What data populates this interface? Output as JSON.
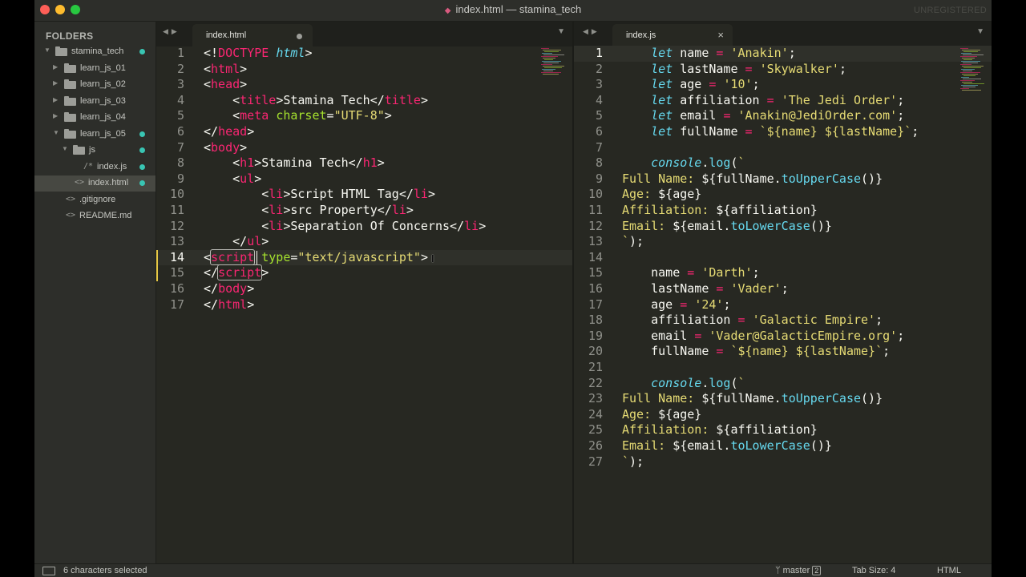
{
  "window": {
    "title": "index.html — stamina_tech",
    "unregistered": "UNREGISTERED"
  },
  "sidebar": {
    "header": "FOLDERS",
    "items": [
      {
        "label": "stamina_tech",
        "type": "folder",
        "expanded": true,
        "level": 0,
        "dot": true
      },
      {
        "label": "learn_js_01",
        "type": "folder",
        "expanded": false,
        "level": 1,
        "dot": false
      },
      {
        "label": "learn_js_02",
        "type": "folder",
        "expanded": false,
        "level": 1,
        "dot": false
      },
      {
        "label": "learn_js_03",
        "type": "folder",
        "expanded": false,
        "level": 1,
        "dot": false
      },
      {
        "label": "learn_js_04",
        "type": "folder",
        "expanded": false,
        "level": 1,
        "dot": false
      },
      {
        "label": "learn_js_05",
        "type": "folder",
        "expanded": true,
        "level": 1,
        "dot": true
      },
      {
        "label": "js",
        "type": "folder",
        "expanded": true,
        "level": 2,
        "dot": true
      },
      {
        "label": "index.js",
        "type": "file",
        "icon": "/*",
        "level": 3,
        "dot": true
      },
      {
        "label": "index.html",
        "type": "file",
        "icon": "<>",
        "level": 2,
        "dot": true,
        "selected": true
      },
      {
        "label": ".gitignore",
        "type": "file",
        "icon": "<>",
        "level": 1,
        "dot": false
      },
      {
        "label": "README.md",
        "type": "file",
        "icon": "<>",
        "level": 1,
        "dot": false
      }
    ]
  },
  "left_pane": {
    "tab_label": "index.html",
    "current_line": 14,
    "dirty_lines": [
      14,
      15
    ],
    "lines": [
      [
        [
          "<!"
        ],
        [
          "DOCTYPE",
          "tag"
        ],
        [
          " "
        ],
        [
          "html",
          "kw2"
        ],
        [
          ">"
        ]
      ],
      [
        [
          "<"
        ],
        [
          "html",
          "tag"
        ],
        [
          ">"
        ]
      ],
      [
        [
          "<"
        ],
        [
          "head",
          "tag"
        ],
        [
          ">"
        ]
      ],
      [
        [
          "    <"
        ],
        [
          "title",
          "tag"
        ],
        [
          ">Stamina Tech</"
        ],
        [
          "title",
          "tag"
        ],
        [
          ">"
        ]
      ],
      [
        [
          "    <"
        ],
        [
          "meta",
          "tag"
        ],
        [
          " "
        ],
        [
          "charset",
          "attr"
        ],
        [
          "="
        ],
        [
          "\"UTF-8\"",
          "str"
        ],
        [
          ">"
        ]
      ],
      [
        [
          "</"
        ],
        [
          "head",
          "tag"
        ],
        [
          ">"
        ]
      ],
      [
        [
          "<"
        ],
        [
          "body",
          "tag"
        ],
        [
          ">"
        ]
      ],
      [
        [
          "    <"
        ],
        [
          "h1",
          "tag"
        ],
        [
          ">Stamina Tech</"
        ],
        [
          "h1",
          "tag"
        ],
        [
          ">"
        ]
      ],
      [
        [
          "    <"
        ],
        [
          "ul",
          "tag"
        ],
        [
          ">"
        ]
      ],
      [
        [
          "        <"
        ],
        [
          "li",
          "tag"
        ],
        [
          ">Script HTML Tag</"
        ],
        [
          "li",
          "tag"
        ],
        [
          ">"
        ]
      ],
      [
        [
          "        <"
        ],
        [
          "li",
          "tag"
        ],
        [
          ">src Property</"
        ],
        [
          "li",
          "tag"
        ],
        [
          ">"
        ]
      ],
      [
        [
          "        <"
        ],
        [
          "li",
          "tag"
        ],
        [
          ">Separation Of Concerns</"
        ],
        [
          "li",
          "tag"
        ],
        [
          ">"
        ]
      ],
      [
        [
          "    </"
        ],
        [
          "ul",
          "tag"
        ],
        [
          ">"
        ]
      ],
      [
        [
          "<"
        ],
        [
          "script",
          "tagsel"
        ],
        [
          " "
        ],
        [
          "type",
          "attr"
        ],
        [
          "="
        ],
        [
          "\"text/javascript\"",
          "str"
        ],
        [
          ">"
        ]
      ],
      [
        [
          "</"
        ],
        [
          "script",
          "tagsel"
        ],
        [
          ">"
        ]
      ],
      [
        [
          "</"
        ],
        [
          "body",
          "tag"
        ],
        [
          ">"
        ]
      ],
      [
        [
          "</"
        ],
        [
          "html",
          "tag"
        ],
        [
          ">"
        ]
      ]
    ]
  },
  "right_pane": {
    "tab_label": "index.js",
    "current_line": 1,
    "lines": [
      [
        [
          "    "
        ],
        [
          "let",
          "kw"
        ],
        [
          " name "
        ],
        [
          "=",
          "op"
        ],
        [
          " "
        ],
        [
          "'Anakin'",
          "str"
        ],
        [
          ";"
        ]
      ],
      [
        [
          "    "
        ],
        [
          "let",
          "kw"
        ],
        [
          " lastName "
        ],
        [
          "=",
          "op"
        ],
        [
          " "
        ],
        [
          "'Skywalker'",
          "str"
        ],
        [
          ";"
        ]
      ],
      [
        [
          "    "
        ],
        [
          "let",
          "kw"
        ],
        [
          " age "
        ],
        [
          "=",
          "op"
        ],
        [
          " "
        ],
        [
          "'10'",
          "str"
        ],
        [
          ";"
        ]
      ],
      [
        [
          "    "
        ],
        [
          "let",
          "kw"
        ],
        [
          " affiliation "
        ],
        [
          "=",
          "op"
        ],
        [
          " "
        ],
        [
          "'The Jedi Order'",
          "str"
        ],
        [
          ";"
        ]
      ],
      [
        [
          "    "
        ],
        [
          "let",
          "kw"
        ],
        [
          " email "
        ],
        [
          "=",
          "op"
        ],
        [
          " "
        ],
        [
          "'Anakin@JediOrder.com'",
          "str"
        ],
        [
          ";"
        ]
      ],
      [
        [
          "    "
        ],
        [
          "let",
          "kw"
        ],
        [
          " fullName "
        ],
        [
          "=",
          "op"
        ],
        [
          " "
        ],
        [
          "`${name} ${lastName}`",
          "str"
        ],
        [
          ";"
        ]
      ],
      [
        [
          ""
        ]
      ],
      [
        [
          "    "
        ],
        [
          "console",
          "kw"
        ],
        [
          "."
        ],
        [
          "log",
          "fn"
        ],
        [
          "("
        ],
        [
          "`",
          "str"
        ]
      ],
      [
        [
          "Full Name: ",
          "str"
        ],
        [
          "${fullName."
        ],
        [
          "toUpperCase",
          "fn"
        ],
        [
          "()}"
        ]
      ],
      [
        [
          "Age: ",
          "str"
        ],
        [
          "${age}"
        ]
      ],
      [
        [
          "Affiliation: ",
          "str"
        ],
        [
          "${affiliation}"
        ]
      ],
      [
        [
          "Email: ",
          "str"
        ],
        [
          "${email."
        ],
        [
          "toLowerCase",
          "fn"
        ],
        [
          "()}"
        ]
      ],
      [
        [
          "`",
          "str"
        ],
        [
          ");"
        ]
      ],
      [
        [
          ""
        ]
      ],
      [
        [
          "    name "
        ],
        [
          "=",
          "op"
        ],
        [
          " "
        ],
        [
          "'Darth'",
          "str"
        ],
        [
          ";"
        ]
      ],
      [
        [
          "    lastName "
        ],
        [
          "=",
          "op"
        ],
        [
          " "
        ],
        [
          "'Vader'",
          "str"
        ],
        [
          ";"
        ]
      ],
      [
        [
          "    age "
        ],
        [
          "=",
          "op"
        ],
        [
          " "
        ],
        [
          "'24'",
          "str"
        ],
        [
          ";"
        ]
      ],
      [
        [
          "    affiliation "
        ],
        [
          "=",
          "op"
        ],
        [
          " "
        ],
        [
          "'Galactic Empire'",
          "str"
        ],
        [
          ";"
        ]
      ],
      [
        [
          "    email "
        ],
        [
          "=",
          "op"
        ],
        [
          " "
        ],
        [
          "'Vader@GalacticEmpire.org'",
          "str"
        ],
        [
          ";"
        ]
      ],
      [
        [
          "    fullName "
        ],
        [
          "=",
          "op"
        ],
        [
          " "
        ],
        [
          "`${name} ${lastName}`",
          "str"
        ],
        [
          ";"
        ]
      ],
      [
        [
          ""
        ]
      ],
      [
        [
          "    "
        ],
        [
          "console",
          "kw"
        ],
        [
          "."
        ],
        [
          "log",
          "fn"
        ],
        [
          "("
        ],
        [
          "`",
          "str"
        ]
      ],
      [
        [
          "Full Name: ",
          "str"
        ],
        [
          "${fullName."
        ],
        [
          "toUpperCase",
          "fn"
        ],
        [
          "()}"
        ]
      ],
      [
        [
          "Age: ",
          "str"
        ],
        [
          "${age}"
        ]
      ],
      [
        [
          "Affiliation: ",
          "str"
        ],
        [
          "${affiliation}"
        ]
      ],
      [
        [
          "Email: ",
          "str"
        ],
        [
          "${email."
        ],
        [
          "toLowerCase",
          "fn"
        ],
        [
          "()}"
        ]
      ],
      [
        [
          "`",
          "str"
        ],
        [
          ");"
        ]
      ]
    ]
  },
  "statusbar": {
    "selection": "6 characters selected",
    "branch": "master",
    "branch_count": "2",
    "tab_size": "Tab Size: 4",
    "syntax": "HTML"
  },
  "colors": {
    "editor_bg": "#272822",
    "tag": "#f92672",
    "attribute": "#a6e22e",
    "string": "#e6db74",
    "keyword": "#66d9ef",
    "modified_dot": "#39c5b3"
  }
}
